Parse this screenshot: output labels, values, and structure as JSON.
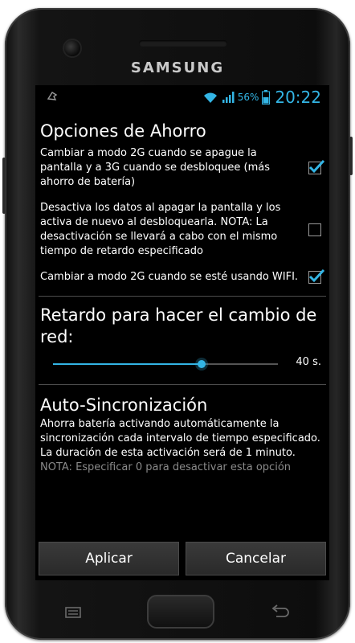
{
  "device": {
    "brand": "SAMSUNG"
  },
  "status_bar": {
    "battery_percent": "56%",
    "time": "20:22",
    "icons": [
      "notification-icon",
      "wifi-icon",
      "signal-icon",
      "battery-icon"
    ]
  },
  "power_saving": {
    "title": "Opciones de Ahorro",
    "options": [
      {
        "text": "Cambiar a modo 2G cuando se apague la pantalla y a 3G cuando se desbloquee (más ahorro de batería)",
        "checked": true
      },
      {
        "text": "Desactiva los datos al apagar la pantalla y los activa de nuevo al desbloquearla. NOTA: La desactivación se llevará a cabo con el mismo tiempo de retardo especificado",
        "checked": false
      },
      {
        "text": "Cambiar a modo 2G cuando se esté usando WIFI.",
        "checked": true
      }
    ]
  },
  "network_delay": {
    "title": "Retardo para hacer el cambio de red:",
    "value_label": "40 s.",
    "slider_fraction": 0.66
  },
  "auto_sync": {
    "title": "Auto-Sincronización",
    "description": "Ahorra batería activando automáticamente la sincronización cada intervalo de tiempo especificado. La duración de esta activación será de 1 minuto.",
    "note": "NOTA: Especificar 0 para desactivar esta opción"
  },
  "buttons": {
    "apply": "Aplicar",
    "cancel": "Cancelar"
  },
  "colors": {
    "accent": "#33b5e5",
    "background": "#000000",
    "text": "#ffffff"
  }
}
